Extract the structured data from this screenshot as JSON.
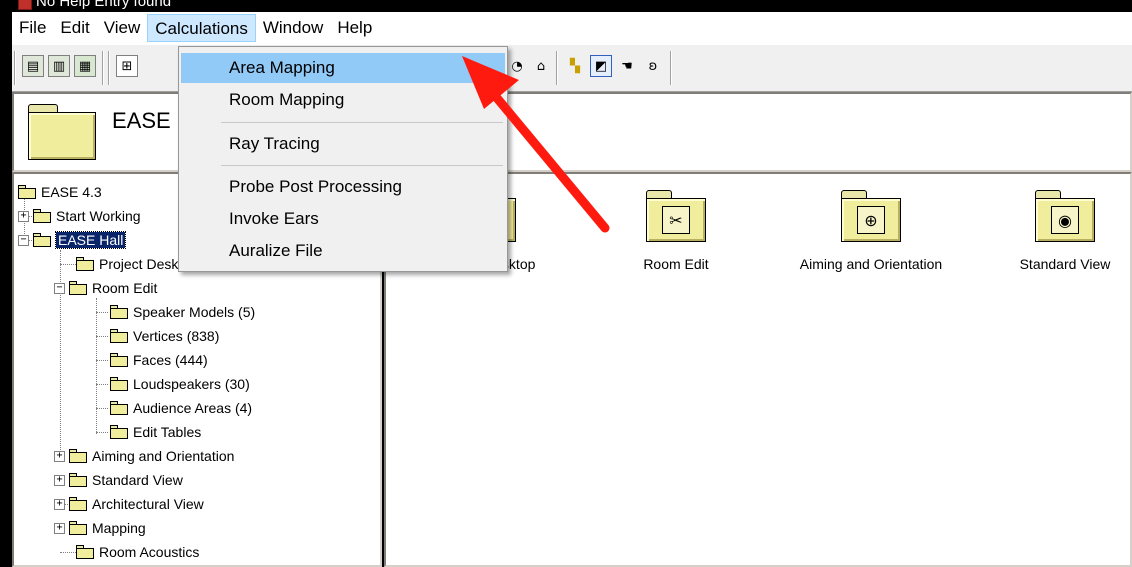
{
  "window": {
    "title": "No Help Entry found"
  },
  "menubar": {
    "items": [
      "File",
      "Edit",
      "View",
      "Calculations",
      "Window",
      "Help"
    ],
    "active": "Calculations"
  },
  "calculations_menu": {
    "items": [
      "Area Mapping",
      "Room Mapping",
      "Ray Tracing",
      "Probe Post Processing",
      "Invoke Ears",
      "Auralize File"
    ],
    "highlighted": "Area Mapping"
  },
  "header": {
    "title": "EASE Hall"
  },
  "tree": {
    "nodes": [
      {
        "label": "EASE 4.3"
      },
      {
        "label": "Start Working"
      },
      {
        "label": "EASE Hall",
        "selected": true
      },
      {
        "label": "Project Desktop"
      },
      {
        "label": "Room Edit"
      },
      {
        "label": "Speaker Models (5)"
      },
      {
        "label": "Vertices (838)"
      },
      {
        "label": "Faces (444)"
      },
      {
        "label": "Loudspeakers (30)"
      },
      {
        "label": "Audience Areas (4)"
      },
      {
        "label": "Edit Tables"
      },
      {
        "label": "Aiming and Orientation"
      },
      {
        "label": "Standard View"
      },
      {
        "label": "Architectural View"
      },
      {
        "label": "Mapping"
      },
      {
        "label": "Room Acoustics"
      }
    ]
  },
  "content": {
    "items": [
      {
        "label": "Project Desktop",
        "icon": "desktop-icon"
      },
      {
        "label": "Room Edit",
        "icon": "tools-icon"
      },
      {
        "label": "Aiming and Orientation",
        "icon": "crosshair-icon"
      },
      {
        "label": "Standard View",
        "icon": "eye-icon"
      }
    ]
  },
  "colors": {
    "menu_highlight": "#91c9f7",
    "tree_selection": "#0a246a",
    "folder_yellow": "#f0ee9c",
    "annotation_arrow": "#ff1a0f"
  }
}
